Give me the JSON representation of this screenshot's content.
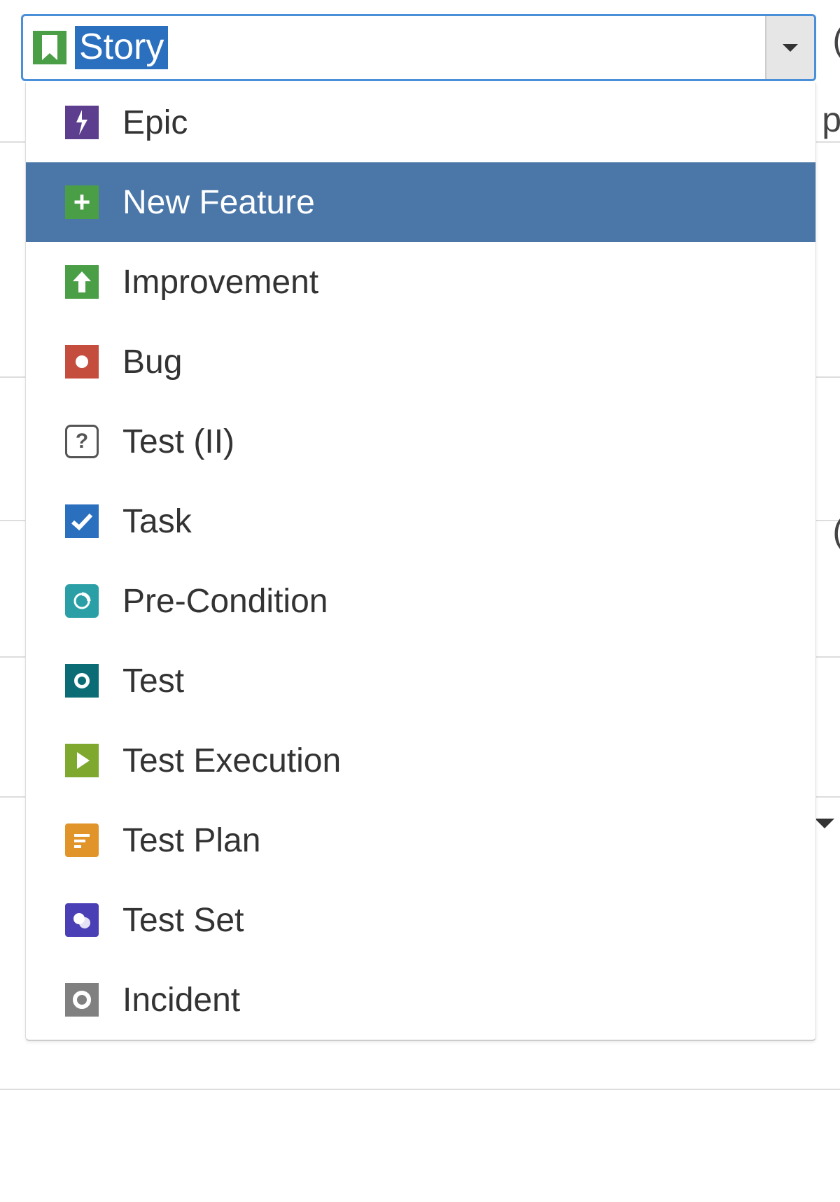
{
  "select": {
    "selected_label": "Story",
    "selected_icon": "story-icon"
  },
  "options": [
    {
      "icon": "epic-icon",
      "label": "Epic",
      "highlight": false
    },
    {
      "icon": "plus-icon",
      "label": "New Feature",
      "highlight": true
    },
    {
      "icon": "arrow-up-icon",
      "label": "Improvement",
      "highlight": false
    },
    {
      "icon": "bug-icon",
      "label": "Bug",
      "highlight": false
    },
    {
      "icon": "question-icon",
      "label": "Test (II)",
      "highlight": false
    },
    {
      "icon": "check-icon",
      "label": "Task",
      "highlight": false
    },
    {
      "icon": "precondition-icon",
      "label": "Pre-Condition",
      "highlight": false
    },
    {
      "icon": "ring-icon",
      "label": "Test",
      "highlight": false
    },
    {
      "icon": "play-icon",
      "label": "Test Execution",
      "highlight": false
    },
    {
      "icon": "plan-icon",
      "label": "Test Plan",
      "highlight": false
    },
    {
      "icon": "set-icon",
      "label": "Test Set",
      "highlight": false
    },
    {
      "icon": "incident-icon",
      "label": "Incident",
      "highlight": false
    }
  ]
}
